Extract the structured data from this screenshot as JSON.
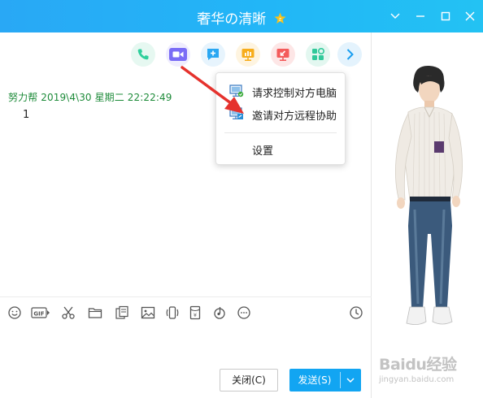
{
  "window": {
    "title": "奢华の清晰"
  },
  "chat": {
    "message": {
      "sender": "努力帮",
      "time": "2019\\4\\30 星期二 22:22:49",
      "text": "1"
    }
  },
  "toolbar": {
    "icons": [
      "phone-icon",
      "video-call-icon",
      "new-chat-icon",
      "share-screen-icon",
      "remote-desktop-icon",
      "apps-icon",
      "more-arrow-icon"
    ],
    "colors": {
      "phone": "#2ecf9c",
      "video": "#7a6cf6",
      "chat": "#2aa7f2",
      "screen": "#f7ad1c",
      "remote": "#f45b5b",
      "apps": "#31c99a",
      "more": "#1a9ef0"
    }
  },
  "remote_menu": {
    "items": [
      {
        "label": "请求控制对方电脑"
      },
      {
        "label": "邀请对方远程协助"
      },
      {
        "label": "设置"
      }
    ]
  },
  "buttons": {
    "close": "关闭(C)",
    "send": "发送(S)"
  },
  "watermark": {
    "main": "Baidu经验",
    "sub": "jingyan.baidu.com"
  },
  "accent": "#12a5f2"
}
